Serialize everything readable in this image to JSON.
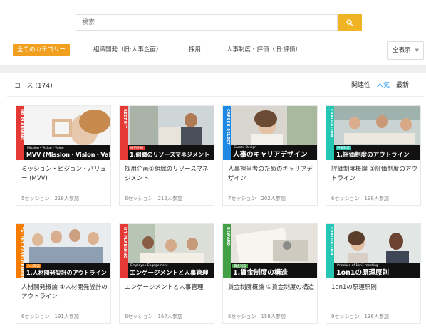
{
  "search": {
    "placeholder": "検索"
  },
  "categories": {
    "all_label": "全てのカテゴリー",
    "items": [
      "組織開発（旧:人事企画）",
      "採用",
      "人事制度・評価（旧:評価）"
    ],
    "show_all_label": "全表示"
  },
  "listing": {
    "count_label": "コース (174)",
    "sort": [
      "関連性",
      "人気",
      "最新"
    ],
    "active_sort": "人気"
  },
  "courses": [
    {
      "stripe_color": "#e53935",
      "side_label": "HR PLANNING",
      "tag": "Mission・Vision・Value",
      "thumb_title": "MVV (Mission・Vision・Value)",
      "title": "ミッション・ビジョン・バリュー (MVV)",
      "meta": "5セッション　218人参加"
    },
    {
      "stripe_color": "#e53935",
      "side_label": "RECRUIT",
      "tag": "採用企画",
      "thumb_title": "1.組織のリソースマネジメント",
      "title": "採用企画①組織のリソースマネジメント",
      "meta": "6セッション　212人参加"
    },
    {
      "stripe_color": "#1e88e5",
      "side_label": "CAREER SELECT",
      "tag": "Career Design",
      "thumb_title": "人事のキャリアデザイン",
      "title": "人事担当者のためのキャリアデザイン",
      "meta": "7セッション　202人参加"
    },
    {
      "stripe_color": "#26c6b4",
      "side_label": "EVALUATION",
      "tag": "評価制度",
      "thumb_title": "1.評価制度のアウトライン",
      "title": "評価制度概論 ①評価制度のアウトライン",
      "meta": "6セッション　198人参加"
    },
    {
      "stripe_color": "#f57c00",
      "side_label": "TALENT DEVELOPMENT",
      "tag": "人材開発",
      "thumb_title": "1.人材開発設計のアウトライン",
      "title": "人材開発概論 ①人材開発設計のアウトライン",
      "meta": "6セッション　191人参加"
    },
    {
      "stripe_color": "#e53935",
      "side_label": "HR PLANNING",
      "tag": "Employee Engagement",
      "thumb_title": "エンゲージメントと人事管理",
      "title": "エンゲージメントと人事管理",
      "meta": "6セッション　167人参加"
    },
    {
      "stripe_color": "#43a047",
      "side_label": "REWARD",
      "tag": "賃金制度",
      "thumb_title": "1.賃金制度の構造",
      "title": "賃金制度概論 ①賃金制度の構造",
      "meta": "6セッション　158人参加"
    },
    {
      "stripe_color": "#26c6b4",
      "side_label": "EVALUATION",
      "tag": "Principle of 1on1 meeting",
      "thumb_title": "1on1の原理原則",
      "title": "1on1の原理原則",
      "meta": "9セッション　136人参加"
    }
  ],
  "colors": {
    "accent": "#f0b323",
    "category_accent": "#f0a01e",
    "active_sort": "#2196f3"
  }
}
